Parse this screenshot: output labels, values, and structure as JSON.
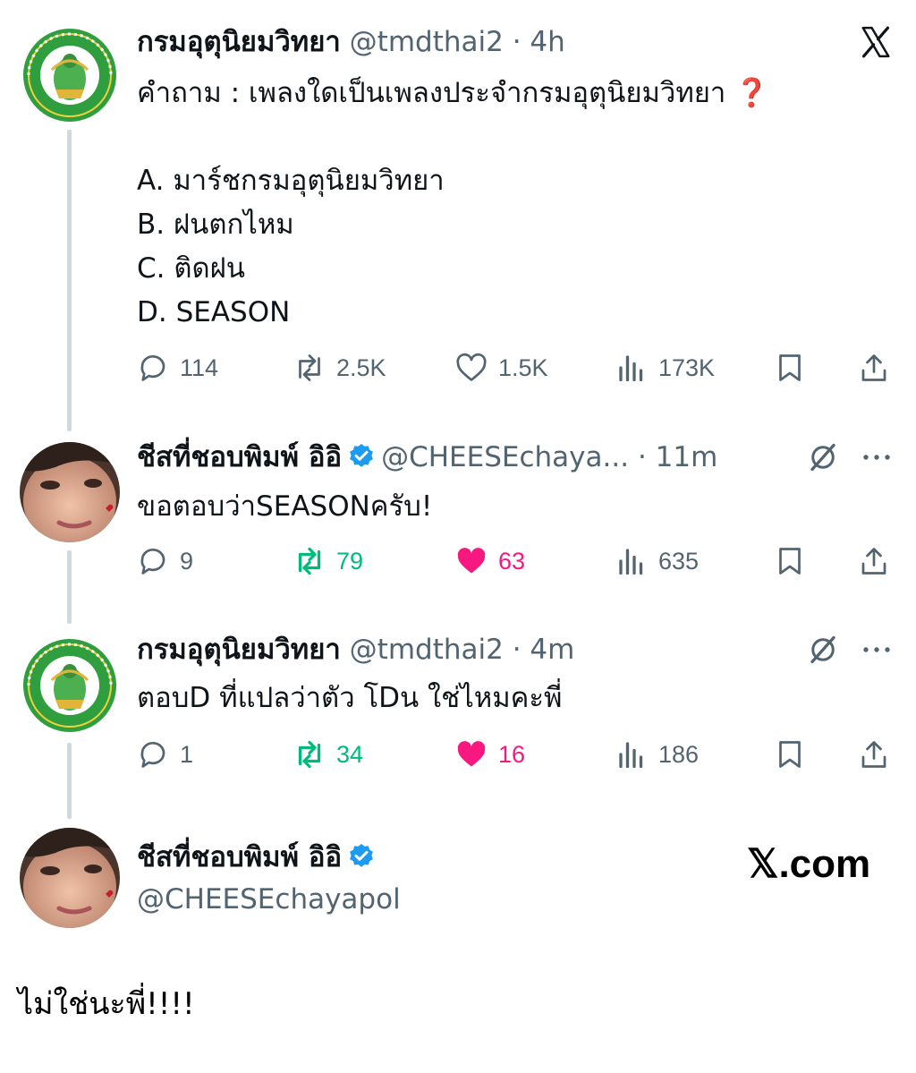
{
  "posts": [
    {
      "name": "กรมอุตุนิยมวิทยา",
      "handle": "@tmdthai2",
      "dot": "·",
      "time": "4h",
      "avatar": "meteorological-department-seal",
      "seal_top_text": "กรมอุตุนิยมวิทยา",
      "seal_bottom_text": "METEOROLOGICAL DEPARTMENT",
      "text_lines": [
        "คำถาม : เพลงใดเป็นเพลงประจำกรมอุตุนิยมวิทยา ❓",
        "",
        "A. มาร์ชกรมอุตุนิยมวิทยา",
        "B. ฝนตกไหม",
        "C. ติดฝน",
        "D. SEASON"
      ],
      "replies": "114",
      "reposts": "2.5K",
      "likes": "1.5K",
      "views": "173K"
    },
    {
      "name": "ชีสที่ชอบพิมพ์ อิอิ",
      "handle": "@CHEESEchaya...",
      "dot": "·",
      "time": "11m",
      "verified": true,
      "avatar": "user-photo",
      "text_lines": [
        "ขอตอบว่าSEASONครับ!"
      ],
      "replies": "9",
      "reposts": "79",
      "likes": "63",
      "views": "635",
      "reposted": true,
      "liked": true
    },
    {
      "name": "กรมอุตุนิยมวิทยา",
      "handle": "@tmdthai2",
      "dot": "·",
      "time": "4m",
      "avatar": "meteorological-department-seal",
      "text_lines": [
        "ตอบD ที่แปลว่าตัว โDน ใช่ไหมคะพี่"
      ],
      "replies": "1",
      "reposts": "34",
      "likes": "16",
      "views": "186",
      "reposted": true,
      "liked": true
    }
  ],
  "profile_card": {
    "name": "ชีสที่ชอบพิมพ์ อิอิ",
    "handle": "@CHEESEchayapol",
    "verified": true,
    "watermark": "𝕏.com"
  },
  "caption": "ไม่ใช่นะพี่!!!!",
  "colors": {
    "green_repost": "#00ba7c",
    "pink_like": "#f91880",
    "verified_blue": "#1d9bf0",
    "muted_text": "#536471",
    "thread_line": "#cfd9de"
  },
  "icons": {
    "top_right_first": "x-logo-icon",
    "top_right_replies": "grok-slash-icon",
    "more": "more-dots-icon"
  }
}
